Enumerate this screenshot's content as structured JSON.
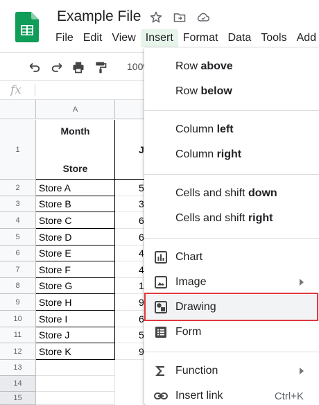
{
  "app": {
    "title": "Example File"
  },
  "menubar": [
    "File",
    "Edit",
    "View",
    "Insert",
    "Format",
    "Data",
    "Tools",
    "Add"
  ],
  "toolbar": {
    "zoom": "100%"
  },
  "formula_bar": {
    "fx": "fx"
  },
  "columns": {
    "a": "A"
  },
  "header_row": {
    "num": "1",
    "month": "Month",
    "store": "Store",
    "b_partial": "J"
  },
  "rows": [
    {
      "num": "2",
      "store": "Store A",
      "b": "5"
    },
    {
      "num": "3",
      "store": "Store B",
      "b": "3"
    },
    {
      "num": "4",
      "store": "Store C",
      "b": "6"
    },
    {
      "num": "5",
      "store": "Store D",
      "b": "6"
    },
    {
      "num": "6",
      "store": "Store E",
      "b": "4"
    },
    {
      "num": "7",
      "store": "Store F",
      "b": "4"
    },
    {
      "num": "8",
      "store": "Store G",
      "b": "1"
    },
    {
      "num": "9",
      "store": "Store H",
      "b": "9"
    },
    {
      "num": "10",
      "store": "Store I",
      "b": "6"
    },
    {
      "num": "11",
      "store": "Store J",
      "b": "5"
    },
    {
      "num": "12",
      "store": "Store K",
      "b": "9"
    }
  ],
  "empty_rows": [
    "13",
    "14",
    "15"
  ],
  "insert_menu": {
    "row_above": {
      "pre": "Row ",
      "bold": "above"
    },
    "row_below": {
      "pre": "Row ",
      "bold": "below"
    },
    "column_left": {
      "pre": "Column ",
      "bold": "left"
    },
    "column_right": {
      "pre": "Column ",
      "bold": "right"
    },
    "cells_down": {
      "pre": "Cells and shift ",
      "bold": "down"
    },
    "cells_right": {
      "pre": "Cells and shift ",
      "bold": "right"
    },
    "chart": "Chart",
    "image": "Image",
    "drawing": "Drawing",
    "form": "Form",
    "function": "Function",
    "insert_link": "Insert link",
    "insert_link_shortcut": "Ctrl+K"
  },
  "colors": {
    "accent": "#0f9d58",
    "highlight_box": "#e0393e",
    "menu_active": "#e6f4ea"
  }
}
